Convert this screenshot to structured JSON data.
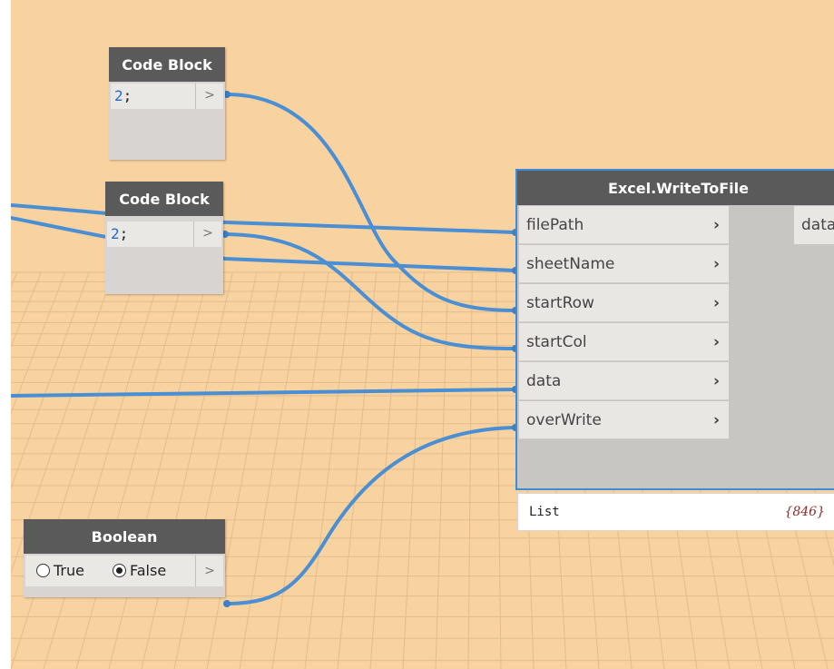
{
  "nodes": {
    "code_block_1": {
      "title": "Code Block",
      "code_value": "2",
      "code_suffix": ";",
      "output_arrow": ">"
    },
    "code_block_2": {
      "title": "Code Block",
      "code_value": "2",
      "code_suffix": ";",
      "output_arrow": ">"
    },
    "excel": {
      "title": "Excel.WriteToFile",
      "inputs": [
        {
          "label": "filePath",
          "chevron": "›"
        },
        {
          "label": "sheetName",
          "chevron": "›"
        },
        {
          "label": "startRow",
          "chevron": "›"
        },
        {
          "label": "startCol",
          "chevron": "›"
        },
        {
          "label": "data",
          "chevron": "›"
        },
        {
          "label": "overWrite",
          "chevron": "›"
        }
      ],
      "output_label": "data",
      "preview": {
        "label": "List",
        "count": "{846}"
      }
    },
    "boolean": {
      "title": "Boolean",
      "true_label": "True",
      "false_label": "False",
      "selected": "False",
      "output_arrow": ">"
    }
  },
  "colors": {
    "canvas": "#f8d29f",
    "wire": "#4a8fd4",
    "node_header": "#5a5a5a",
    "selection_border": "#3e8bd8",
    "code_number": "#1f6ad6"
  },
  "icons": {
    "radio_unselected": "radio-empty-icon",
    "radio_selected": "radio-filled-icon",
    "chevron": "chevron-right-icon"
  }
}
